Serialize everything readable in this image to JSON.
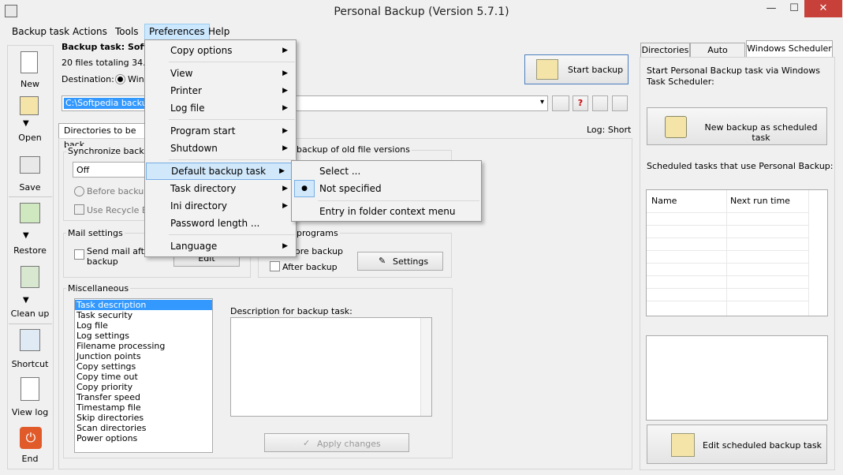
{
  "window": {
    "title": "Personal Backup (Version 5.7.1)",
    "controls": {
      "minimize": "—",
      "maximize": "☐",
      "close": "✕"
    }
  },
  "menubar": [
    "Backup task",
    "Actions",
    "Tools",
    "Preferences",
    "Help"
  ],
  "left_toolbar": [
    "New",
    "Open",
    "Save",
    "Restore",
    "Clean up",
    "Shortcut",
    "View log",
    "End"
  ],
  "task_header": {
    "line1": "Backup task: Softp",
    "line2": "20 files totaling 34.98",
    "destination_label": "Destination:",
    "destination_option": "Windo",
    "path": "C:\\Softpedia backup\\"
  },
  "start_backup": "Start backup",
  "tabs_center": {
    "dirs_tab": "Directories to be back",
    "log_label": "Log: Short"
  },
  "sync_group": {
    "title": "Synchronize backup",
    "select_value": "Off",
    "before_backup": "Before backup",
    "use_recycle": "Use Recycle Bin"
  },
  "old_versions_group": {
    "title": "backup of old file versions"
  },
  "mail_group": {
    "title": "Mail settings",
    "send_mail": "Send mail after",
    "send_mail_2": "backup",
    "edit_button": "Edit"
  },
  "programs_group": {
    "title": "programs",
    "before_backup": "ore backup",
    "after_backup": "After backup",
    "settings_button": "Settings"
  },
  "misc_group": {
    "title": "Miscellaneous",
    "items": [
      "Task description",
      "Task security",
      "Log file",
      "Log settings",
      "Filename processing",
      "Junction points",
      "Copy settings",
      "Copy time out",
      "Copy priority",
      "Transfer speed",
      "Timestamp file",
      "Skip directories",
      "Scan directories",
      "Power options"
    ],
    "description_label": "Description for backup task:",
    "apply_button": "Apply changes"
  },
  "preferences_menu": [
    "Copy options",
    "View",
    "Printer",
    "Log file",
    "Program start",
    "Shutdown",
    "Default backup task",
    "Task directory",
    "Ini directory",
    "Password length ...",
    "Language"
  ],
  "submenu": [
    "Select ...",
    "Not specified",
    "Entry in folder context menu"
  ],
  "right_tabs": [
    "Directories",
    "Auto Backup",
    "Windows Scheduler"
  ],
  "scheduler": {
    "intro": "Start Personal Backup task via Windows Task Scheduler:",
    "new_button": "New backup as scheduled task",
    "tasks_label": "Scheduled tasks that use Personal Backup:",
    "columns": [
      "Name",
      "Next run time"
    ],
    "edit_button": "Edit scheduled backup task"
  },
  "colors": {
    "selection": "#3399ff",
    "menu_highlight": "#d1e8fb",
    "close": "#c7413a"
  }
}
